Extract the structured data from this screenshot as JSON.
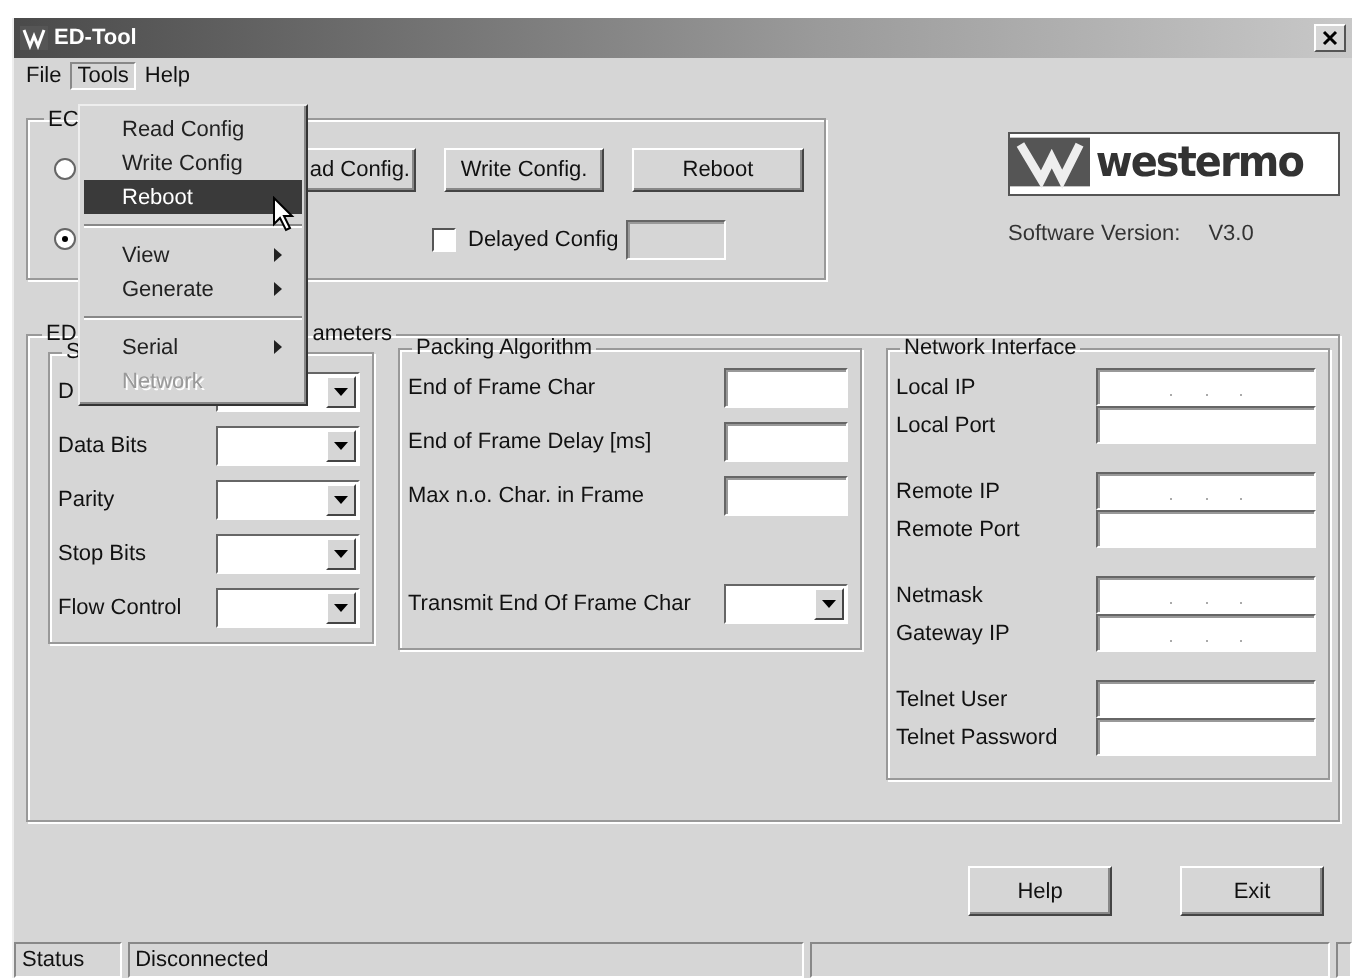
{
  "window": {
    "title": "ED-Tool"
  },
  "menu_bar": [
    {
      "label": "File",
      "selected": false
    },
    {
      "label": "Tools",
      "selected": true
    },
    {
      "label": "Help",
      "selected": false
    }
  ],
  "dropdown_menu": [
    {
      "kind": "item",
      "label": "Read Config",
      "submenu": false,
      "disabled": false,
      "selected": false
    },
    {
      "kind": "item",
      "label": "Write Config",
      "submenu": false,
      "disabled": false,
      "selected": false
    },
    {
      "kind": "item",
      "label": "Reboot",
      "submenu": false,
      "disabled": false,
      "selected": true
    },
    {
      "kind": "separator"
    },
    {
      "kind": "item",
      "label": "View",
      "submenu": true,
      "disabled": false,
      "selected": false
    },
    {
      "kind": "item",
      "label": "Generate",
      "submenu": true,
      "disabled": false,
      "selected": false
    },
    {
      "kind": "separator"
    },
    {
      "kind": "item",
      "label": "Serial",
      "submenu": true,
      "disabled": false,
      "selected": false
    },
    {
      "kind": "item",
      "label": "Network",
      "submenu": false,
      "disabled": true,
      "selected": false
    }
  ],
  "config_group": {
    "title": "EC",
    "radios": [
      {
        "selected": false
      },
      {
        "selected": true
      }
    ],
    "buttons": [
      "ad Config.",
      "Write Config.",
      "Reboot"
    ],
    "delayed_config": {
      "label": "Delayed Config",
      "checked": false
    }
  },
  "logo": {
    "text": "westermo"
  },
  "software_version": {
    "label": "Software Version:",
    "value": "V3.0"
  },
  "params_group": {
    "title_start": "ED",
    "title_end": "ameters"
  },
  "serial_group": {
    "title": "S",
    "rows": [
      {
        "label": "D"
      },
      {
        "label": "Data Bits"
      },
      {
        "label": "Parity"
      },
      {
        "label": "Stop Bits"
      },
      {
        "label": "Flow Control"
      }
    ]
  },
  "packing_group": {
    "title": "Packing Algorithm",
    "rows": [
      {
        "label": "End of Frame Char",
        "kind": "text"
      },
      {
        "label": "End of Frame Delay [ms]",
        "kind": "text"
      },
      {
        "label": "Max n.o. Char. in Frame",
        "kind": "text"
      },
      {
        "label": "Transmit End Of Frame Char",
        "kind": "combo"
      }
    ]
  },
  "network_group": {
    "title": "Network Interface",
    "rows": [
      {
        "label": "Local IP",
        "kind": "ip"
      },
      {
        "label": "Local Port",
        "kind": "text"
      },
      {
        "label": "Remote IP",
        "kind": "ip"
      },
      {
        "label": "Remote Port",
        "kind": "text"
      },
      {
        "label": "Netmask",
        "kind": "ip"
      },
      {
        "label": "Gateway IP",
        "kind": "ip"
      },
      {
        "label": "Telnet User",
        "kind": "text"
      },
      {
        "label": "Telnet Password",
        "kind": "text"
      }
    ]
  },
  "buttons": [
    "Help",
    "Exit"
  ],
  "status_bar": [
    "Status",
    "Disconnected"
  ]
}
